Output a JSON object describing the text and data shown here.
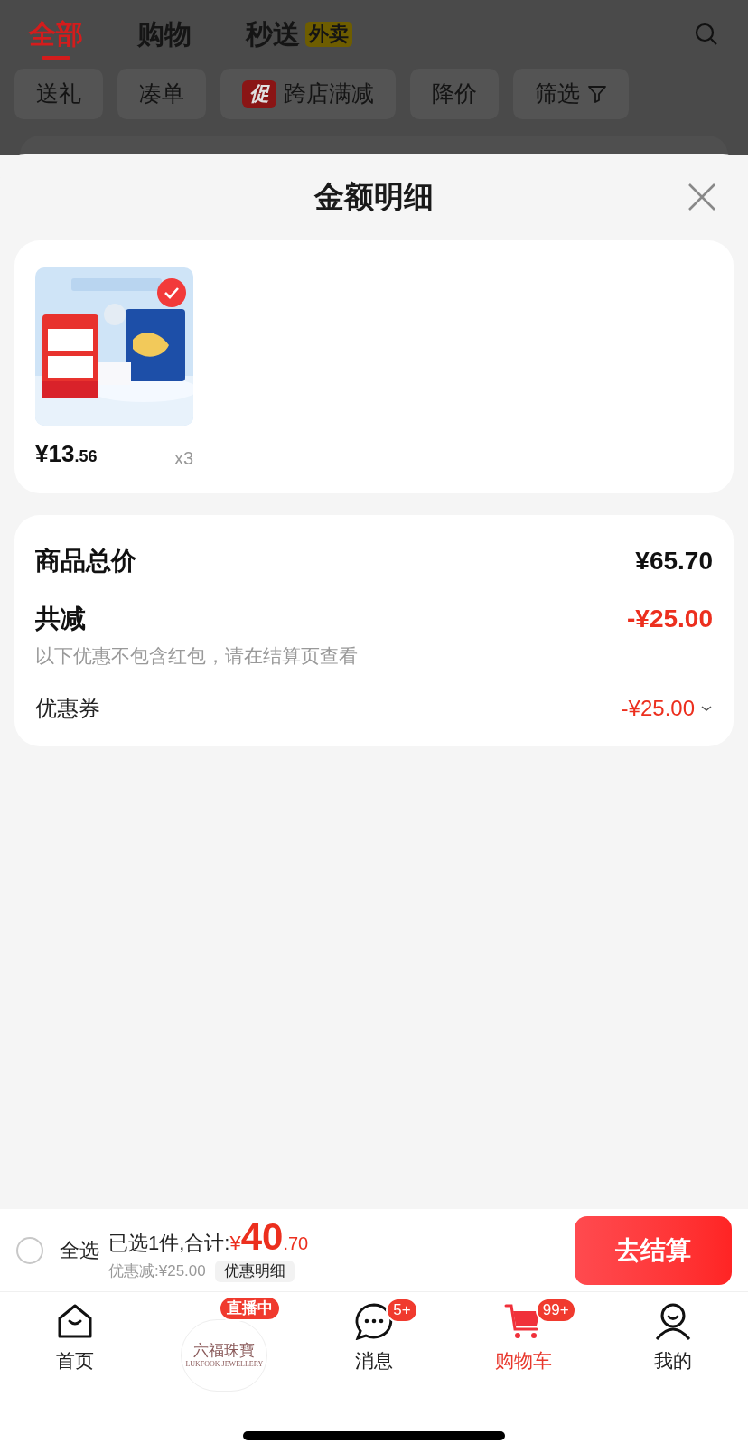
{
  "top_tabs": [
    {
      "label": "全部",
      "selected": true
    },
    {
      "label": "购物",
      "selected": false
    },
    {
      "label": "秒送",
      "selected": false,
      "badge": "外卖"
    }
  ],
  "filters": [
    {
      "label": "送礼"
    },
    {
      "label": "凑单"
    },
    {
      "label": "跨店满减",
      "promo": "促"
    },
    {
      "label": "降价"
    },
    {
      "label": "筛选",
      "kind": "filter"
    }
  ],
  "sheet": {
    "title": "金额明细",
    "items": [
      {
        "kind": "picture",
        "selected": true,
        "price_yuan": "¥13",
        "price_fen": ".56",
        "quantity": "x3"
      }
    ],
    "summary": {
      "total_label": "商品总价",
      "total": "¥65.70",
      "discount_label": "共减",
      "discount": "-¥25.00",
      "note": "以下优惠不包含红包，请在结算页查看",
      "coupon_label": "优惠券",
      "coupon": "-¥25.00"
    }
  },
  "checkout": {
    "select_all": {
      "label": "全选",
      "checked": false
    },
    "selected_text": "已选1件,合计:",
    "currency": "¥",
    "amount_int": "40",
    "amount_dec": ".70",
    "discount_text": "优惠减:¥25.00",
    "details_button": "优惠明细",
    "submit": "去结算"
  },
  "nav": [
    {
      "kind": "home",
      "label": "首页",
      "selected": false
    },
    {
      "kind": "live",
      "badge": "直播中",
      "logo": "六福珠寶",
      "logo_sub": "LUKFOOK JEWELLERY"
    },
    {
      "kind": "message",
      "label": "消息",
      "badge": "5+",
      "selected": false
    },
    {
      "kind": "cart",
      "label": "购物车",
      "badge": "99+",
      "selected": true
    },
    {
      "kind": "me",
      "label": "我的",
      "selected": false
    }
  ]
}
